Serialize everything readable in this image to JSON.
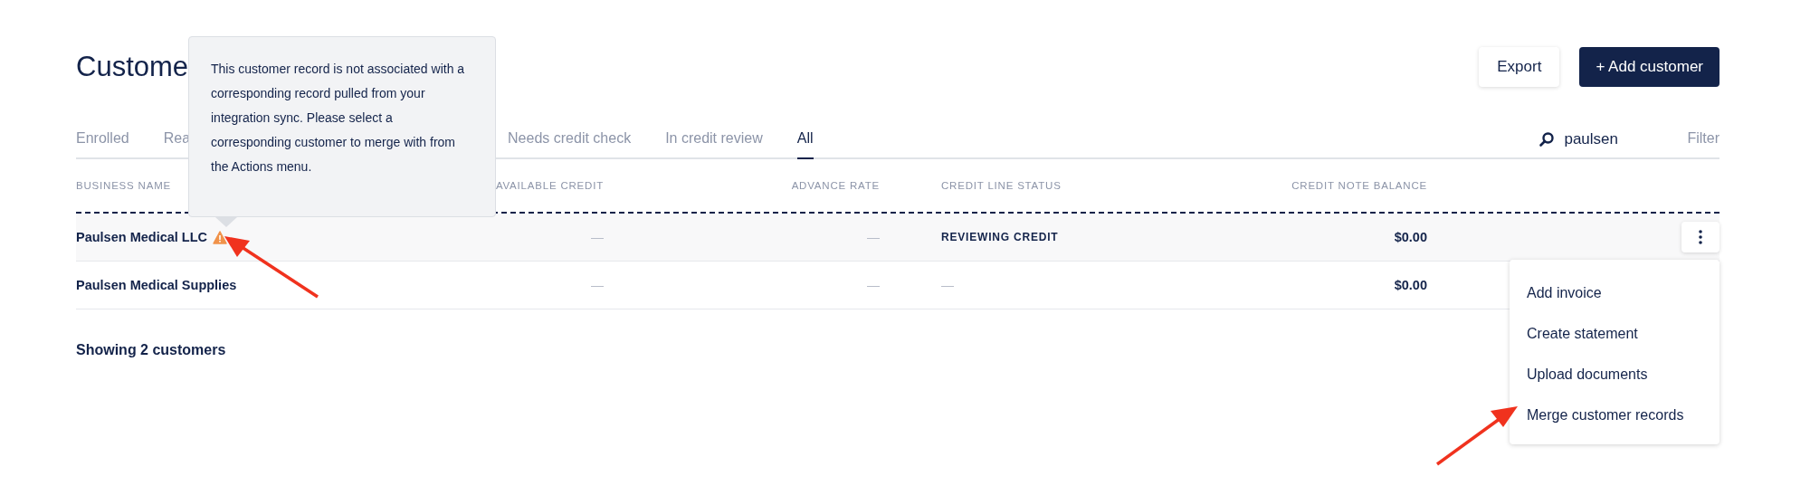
{
  "page": {
    "title": "Custome"
  },
  "toolbar": {
    "buttons": [
      {
        "label": "Export",
        "kind": "secondary"
      },
      {
        "label": "+ Add customer",
        "kind": "primary"
      }
    ]
  },
  "tabs": [
    {
      "label": "Enrolled",
      "selected": false
    },
    {
      "label": "Rea",
      "selected": false
    },
    {
      "label": "Needs credit check",
      "selected": false
    },
    {
      "label": "In credit review",
      "selected": false
    },
    {
      "label": "All",
      "selected": true
    }
  ],
  "search": {
    "value": "paulsen"
  },
  "filter": {
    "label": "Filter"
  },
  "table": {
    "columns": [
      "BUSINESS NAME",
      "AVAILABLE CREDIT",
      "ADVANCE RATE",
      "CREDIT LINE STATUS",
      "CREDIT NOTE BALANCE"
    ],
    "rows": [
      {
        "name": "Paulsen Medical LLC",
        "warning": true,
        "selected": true,
        "available_credit": "—",
        "advance_rate": "—",
        "status": "REVIEWING CREDIT",
        "balance": "$0.00"
      },
      {
        "name": "Paulsen Medical Supplies",
        "warning": false,
        "selected": false,
        "available_credit": "—",
        "advance_rate": "—",
        "status": "—",
        "balance": "$0.00"
      }
    ]
  },
  "footer": {
    "text": "Showing 2 customers"
  },
  "tooltip": {
    "text": "This customer record is not associated with a corresponding record pulled from your integration sync. Please select a corresponding customer to merge with from the Actions menu."
  },
  "actions_menu": {
    "items": [
      "Add invoice",
      "Create statement",
      "Upload documents",
      "Merge customer records"
    ]
  }
}
